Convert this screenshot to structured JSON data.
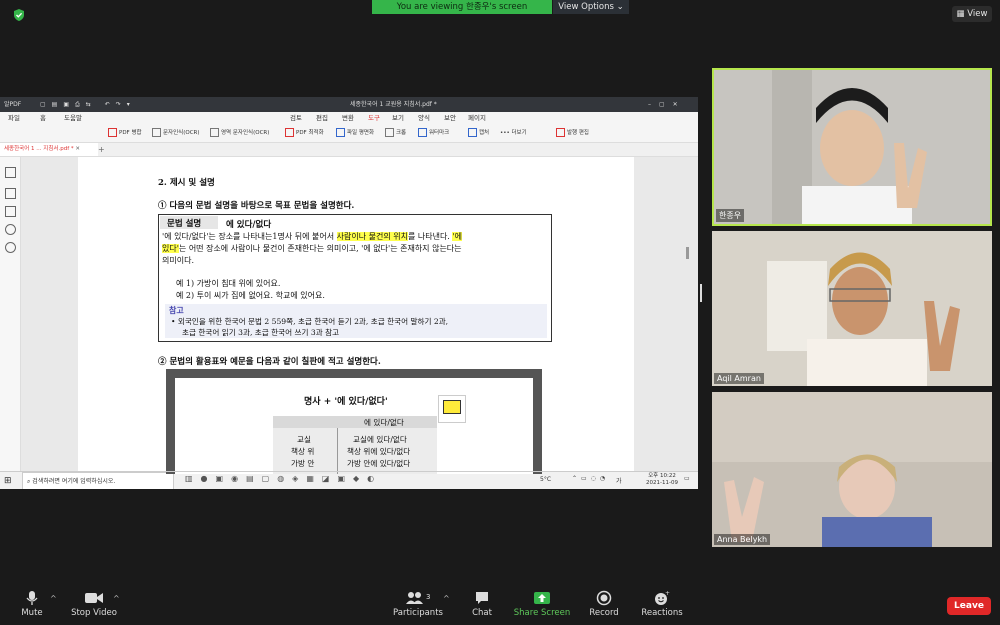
{
  "top": {
    "banner": "You are viewing 한종우's screen",
    "view_options": "View Options",
    "view": "View"
  },
  "app": {
    "name": "알PDF",
    "window_title": "세종한국어 1 교원용 지침서.pdf *",
    "menus": [
      "파일",
      "홈",
      "도움말",
      "검토",
      "편집",
      "변환",
      "도구",
      "보기",
      "양식",
      "보안",
      "페이지"
    ],
    "active_menu": "도구",
    "tools": [
      "PDF 병합",
      "문자인식(OCR)",
      "영역 문자인식(OCR)",
      "PDF 최적화",
      "파일 평면화",
      "크롭",
      "워터마크",
      "캡처",
      "더보기",
      "발행 편집"
    ],
    "tab": "세종한국어 1 ... 지침서.pdf *"
  },
  "document": {
    "section": "2. 제시 및 설명",
    "item1": "① 다음의 문법 설명을 바탕으로 목표 문법을 설명한다.",
    "grammar_label": "문법 설명",
    "grammar_title": "에 있다/없다",
    "line1_a": "'에 있다/없다'는 장소를 나타내는1명사 뒤에 붙어서 ",
    "line1_hl": "사람이나 물건의 위치",
    "line1_b": "를 나타낸다. ",
    "line1_hl2": "'에",
    "line2_hl": "있다'",
    "line2_b": "는 어떤 장소에 사람이나 물건이 존재한다는 의미이고, '에 없다'는 존재하지 않는다는",
    "line3": "의미이다.",
    "ex1": "예 1) 가방이 침대 위에 있어요.",
    "ex2": "예 2) 투이 씨가 집에 없어요. 학교에 있어요.",
    "note_label": "참고",
    "note1": "• 외국인을 위한 한국어 문법 2 559쪽, 초급 한국어 듣기 2과, 초급 한국어 말하기 2과,",
    "note2": "초급 한국어 읽기 3과, 초급 한국어 쓰기 3과 참고",
    "item2": "② 문법의 활용표와 예문을 다음과 같이 칠판에 적고 설명한다.",
    "board_title": "명사 + '에 있다/없다'",
    "table_head": "에 있다/없다",
    "col1": [
      "교실",
      "책상 위",
      "가방 안"
    ],
    "col2": [
      "교실에 있다/없다",
      "책상 위에 있다/없다",
      "가방 안에 있다/없다"
    ]
  },
  "taskbar": {
    "search": "검색하려면 여기에 입력하십시오.",
    "weather": "5°C",
    "ime": "가",
    "time": "오후 10:22",
    "date": "2021-11-09"
  },
  "participants": [
    {
      "name": "한종우"
    },
    {
      "name": "Aqil Amran"
    },
    {
      "name": "Anna Belykh"
    }
  ],
  "controls": {
    "mute": "Mute",
    "stop_video": "Stop Video",
    "participants": "Participants",
    "participants_count": "3",
    "chat": "Chat",
    "share_screen": "Share Screen",
    "record": "Record",
    "reactions": "Reactions",
    "leave": "Leave"
  },
  "colors": {
    "share_green": "#35b54a",
    "active_speaker": "#b6e64d",
    "leave_red": "#e02828"
  }
}
